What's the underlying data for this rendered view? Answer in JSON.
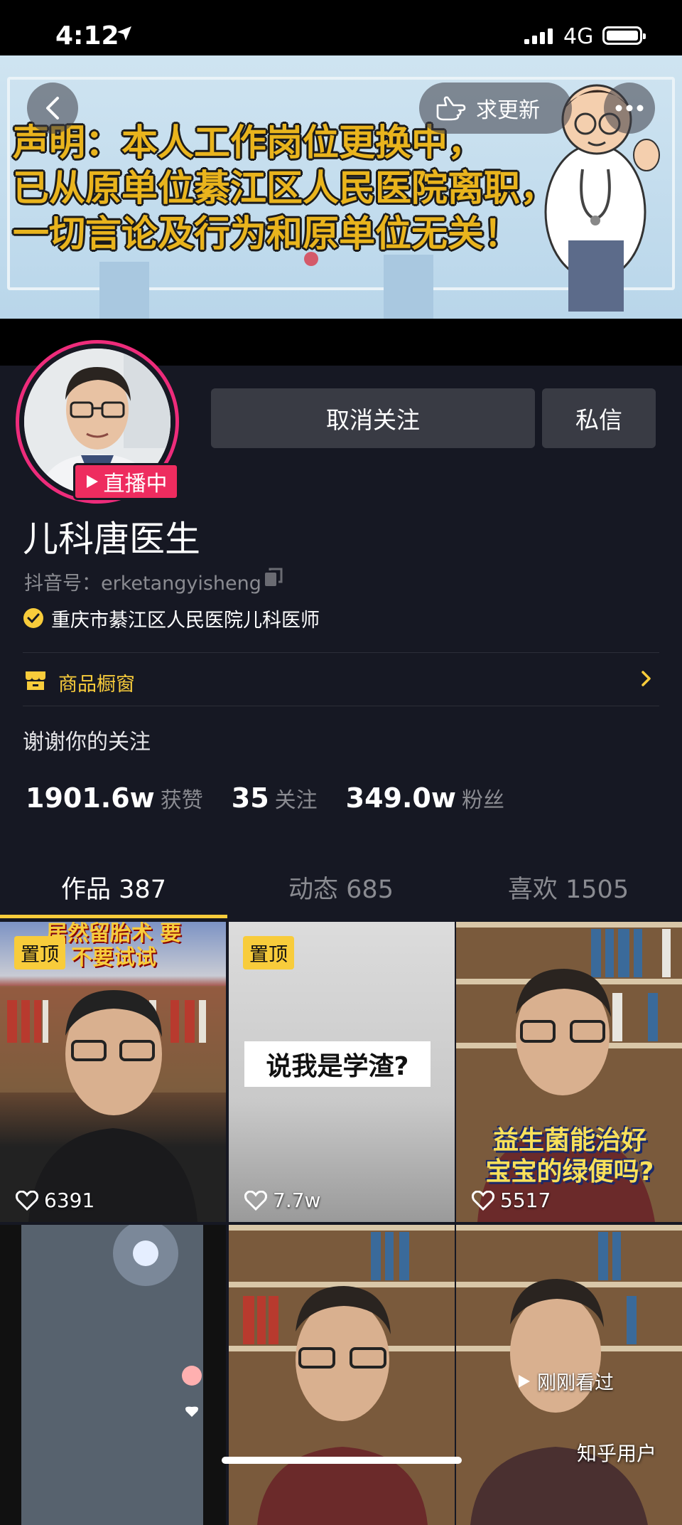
{
  "status_bar": {
    "time": "4:12",
    "network": "4G"
  },
  "banner": {
    "lines": [
      "声明：本人工作岗位更换中，",
      "已从原单位綦江区人民医院离职，",
      "一切言论及行为和原单位无关！"
    ],
    "update_button": "求更新"
  },
  "profile": {
    "live_badge": "直播中",
    "unfollow_button": "取消关注",
    "message_button": "私信",
    "name": "儿科唐医生",
    "handle_prefix": "抖音号：",
    "handle": "erketangyisheng",
    "verification": "重庆市綦江区人民医院儿科医师",
    "shop_label": "商品橱窗",
    "bio": "谢谢你的关注",
    "stats": [
      {
        "value": "1901.6w",
        "label": "获赞"
      },
      {
        "value": "35",
        "label": "关注"
      },
      {
        "value": "349.0w",
        "label": "粉丝"
      }
    ]
  },
  "tabs": [
    {
      "label": "作品 387",
      "active": true
    },
    {
      "label": "动态 685",
      "active": false
    },
    {
      "label": "喜欢 1505",
      "active": false
    }
  ],
  "videos": [
    {
      "pinned": true,
      "pin_label": "置顶",
      "caption": "居然留胎术 要不要试试",
      "likes": "6391"
    },
    {
      "pinned": true,
      "pin_label": "置顶",
      "caption": "说我是学渣?",
      "likes": "7.7w"
    },
    {
      "pinned": false,
      "caption": "益生菌能治好 宝宝的绿便吗?",
      "likes": "5517"
    },
    {
      "pinned": false,
      "caption": "",
      "likes": ""
    },
    {
      "pinned": false,
      "caption": "",
      "likes": ""
    },
    {
      "pinned": false,
      "caption": "",
      "likes": "",
      "watched_label": "刚刚看过"
    }
  ],
  "watermark": "知乎用户",
  "colors": {
    "background": "#161823",
    "accent_yellow": "#f8cc3b",
    "live_pink": "#ee2c5f"
  }
}
